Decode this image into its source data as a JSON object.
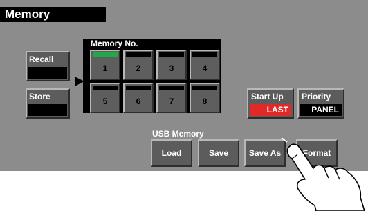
{
  "window": {
    "title": "Memory"
  },
  "recall": {
    "label": "Recall"
  },
  "store": {
    "label": "Store"
  },
  "memory": {
    "header": "Memory No.",
    "slots": [
      {
        "number": "1",
        "active": true
      },
      {
        "number": "2",
        "active": false
      },
      {
        "number": "3",
        "active": false
      },
      {
        "number": "4",
        "active": false
      },
      {
        "number": "5",
        "active": false
      },
      {
        "number": "6",
        "active": false
      },
      {
        "number": "7",
        "active": false
      },
      {
        "number": "8",
        "active": false
      }
    ]
  },
  "startup": {
    "label": "Start Up",
    "value": "LAST",
    "value_color": "#e02a2a"
  },
  "priority": {
    "label": "Priority",
    "value": "PANEL",
    "value_color": "#000000"
  },
  "usb": {
    "title": "USB Memory",
    "buttons": {
      "load": "Load",
      "save": "Save",
      "save_as": "Save As",
      "format": "Format"
    }
  },
  "colors": {
    "panel_bg": "#8c8c8c",
    "active_slot_indicator": "#21a84a",
    "button_face": "#5c5c5c"
  },
  "icons": {
    "pointer_hand": "pointing-hand-icon",
    "selection_arrow": "right-triangle-arrow-icon"
  }
}
